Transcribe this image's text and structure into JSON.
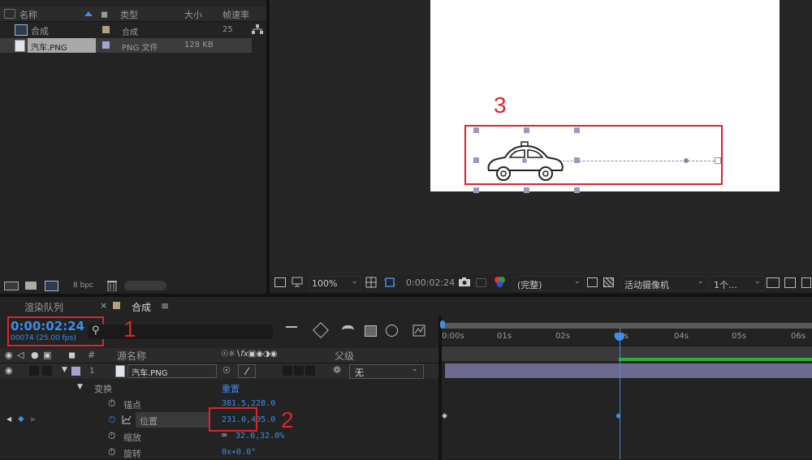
{
  "project": {
    "headers": {
      "name": "名称",
      "type": "类型",
      "size": "大小",
      "fps": "帧速率"
    },
    "items": [
      {
        "name": "合成",
        "type": "合成",
        "size": "",
        "fps": "25",
        "label_color": "#b4a07d",
        "icon": "composition-icon"
      },
      {
        "name": "汽车.PNG",
        "type": "PNG 文件",
        "size": "128 KB",
        "fps": "",
        "label_color": "#a8a2d8",
        "icon": "image-file-icon"
      }
    ],
    "bpc": "8 bpc"
  },
  "viewer": {
    "zoom": "100%",
    "time": "0:00:02:24",
    "quality": "(完整)",
    "camera": "活动摄像机",
    "views": "1个…",
    "annotation": "3"
  },
  "timeline": {
    "tabs": [
      {
        "label": "渲染队列"
      },
      {
        "label": "合成"
      }
    ],
    "current_time": "0:00:02:24",
    "frame_info": "00074 (25.00 fps)",
    "annotation_time": "1",
    "annotation_value": "2",
    "ruler": [
      "0:00s",
      "01s",
      "02s",
      "03s",
      "04s",
      "05s",
      "06s"
    ],
    "cols": {
      "hash": "#",
      "source": "源名称",
      "parent": "父级"
    },
    "layer": {
      "num": "1",
      "name": "汽车.PNG",
      "parent": "无",
      "label_color": "#a8a2d8"
    },
    "transform": {
      "label": "变换",
      "reset": "重置"
    },
    "props": [
      {
        "name": "锚点",
        "value": "381.5,228.0"
      },
      {
        "name": "位置",
        "value": "231.0,405.0"
      },
      {
        "name": "缩放",
        "value": "32.0,32.0%"
      },
      {
        "name": "旋转",
        "value": "0x+0.0°"
      }
    ]
  },
  "colors": {
    "accent": "#3c8ee8",
    "annotation": "#d8262c",
    "track_green": "#22b33a",
    "layer_bar": "#6d6a8f"
  }
}
